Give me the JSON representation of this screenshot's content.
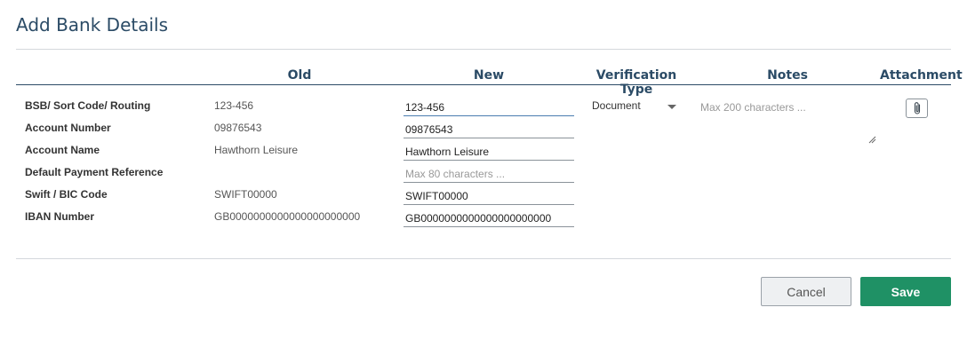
{
  "title": "Add Bank Details",
  "columns": {
    "old": "Old",
    "new": "New",
    "verification_type": "Verification Type",
    "notes": "Notes",
    "attachment": "Attachment"
  },
  "rows": [
    {
      "label": "BSB/ Sort Code/ Routing",
      "old": "123-456",
      "new": "123-456",
      "new_placeholder": ""
    },
    {
      "label": "Account Number",
      "old": "09876543",
      "new": "09876543",
      "new_placeholder": ""
    },
    {
      "label": "Account Name",
      "old": "Hawthorn Leisure",
      "new": "Hawthorn Leisure",
      "new_placeholder": ""
    },
    {
      "label": "Default Payment Reference",
      "old": "",
      "new": "",
      "new_placeholder": "Max 80 characters ..."
    },
    {
      "label": "Swift / BIC Code",
      "old": "SWIFT00000",
      "new": "SWIFT00000",
      "new_placeholder": ""
    },
    {
      "label": "IBAN Number",
      "old": "GB0000000000000000000000",
      "new": "GB0000000000000000000000",
      "new_placeholder": ""
    }
  ],
  "verification": {
    "selected": "Document"
  },
  "notes": {
    "placeholder": "Max 200 characters ..."
  },
  "icons": {
    "attachment": "paperclip-icon",
    "dropdown": "chevron-down-icon"
  },
  "buttons": {
    "cancel": "Cancel",
    "save": "Save"
  },
  "colors": {
    "heading": "#2b4b66",
    "save": "#1f9165",
    "cancel_bg": "#eef0f2"
  }
}
